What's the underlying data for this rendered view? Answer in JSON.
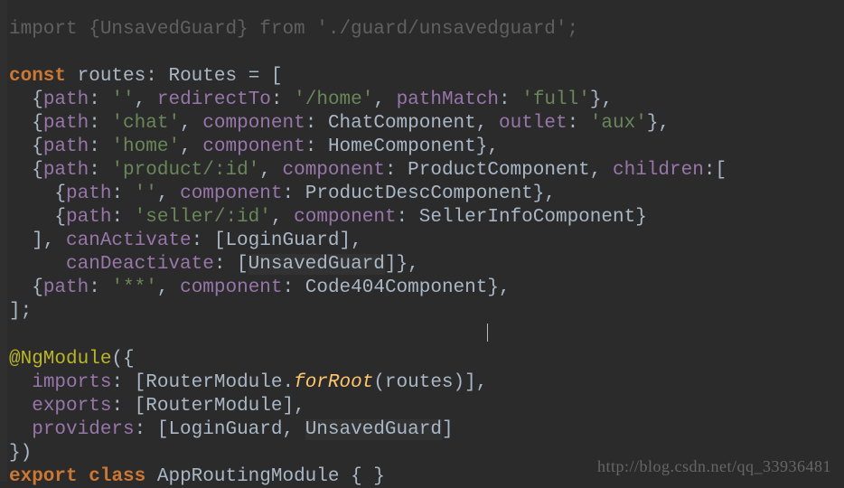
{
  "code": {
    "topDim": "import {UnsavedGuard} from './guard/unsavedguard';",
    "kw_const": "const",
    "id_routes": "routes",
    "op_colon": ": ",
    "id_Routes": "Routes",
    "op_eq": " = [",
    "l2_path": "path",
    "l2_empty": "''",
    "l2_redirectTo": "redirectTo",
    "l2_home": "'/home'",
    "l2_pathMatch": "pathMatch",
    "l2_full": "'full'",
    "l3_chat": "'chat'",
    "l3_component": "component",
    "l3_ChatComponent": "ChatComponent",
    "l3_outlet": "outlet",
    "l3_aux": "'aux'",
    "l4_home": "'home'",
    "l4_HomeComponent": "HomeComponent",
    "l5_product": "'product/:id'",
    "l5_ProductComponent": "ProductComponent",
    "l5_children": "children",
    "l6_ProductDesc": "ProductDescComponent",
    "l7_seller": "'seller/:id'",
    "l7_SellerInfo": "SellerInfoComponent",
    "l8_canActivate": "canActivate",
    "l8_LoginGuard": "LoginGuard",
    "l9_canDeactivate": "canDeactivate",
    "l9_UnsavedGuard": "UnsavedGuard",
    "l10_wild": "'**'",
    "l10_Code404": "Code404Component",
    "ngModule": "@NgModule",
    "l12_imports": "imports",
    "l12_RouterModule": "RouterModule",
    "l12_forRoot": "forRoot",
    "l12_routesArg": "routes",
    "l13_exports": "exports",
    "l14_providers": "providers",
    "l15_export": "export",
    "l15_class": "class",
    "l15_AppRoutingModule": "AppRoutingModule"
  },
  "watermark": "http://blog.csdn.net/qq_33936481"
}
